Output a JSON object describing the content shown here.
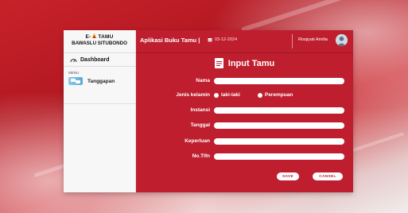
{
  "brand": {
    "line1_prefix": "E-",
    "line1_suffix": "TAMU",
    "line2": "BAWASLU SITUBONDO"
  },
  "sidebar": {
    "dashboard_label": "Dashboard",
    "menu_label": "MENU",
    "items": [
      {
        "label": "Tanggapan",
        "icon": "chat-bubbles-icon"
      }
    ]
  },
  "header": {
    "title": "Aplikasi Buku Tamu |",
    "date": "03-12-2024",
    "user": "Risqiyati Amilia"
  },
  "form": {
    "title": "Input Tamu",
    "fields": {
      "nama": {
        "label": "Nama",
        "value": ""
      },
      "jenis_kelamin": {
        "label": "Jenis kelamin",
        "options": [
          "laki-laki",
          "Perempuan"
        ]
      },
      "instansi": {
        "label": "Instansi",
        "value": ""
      },
      "tanggal": {
        "label": "Tanggal",
        "value": ""
      },
      "keperluan": {
        "label": "Keperluan",
        "value": ""
      },
      "no_tlfn": {
        "label": "No.Tlfn",
        "value": ""
      }
    },
    "save_label": "SAVE",
    "cancel_label": "CANSEL"
  },
  "colors": {
    "primary": "#be1e2d",
    "sidebar_bg": "#f7f7f7"
  }
}
